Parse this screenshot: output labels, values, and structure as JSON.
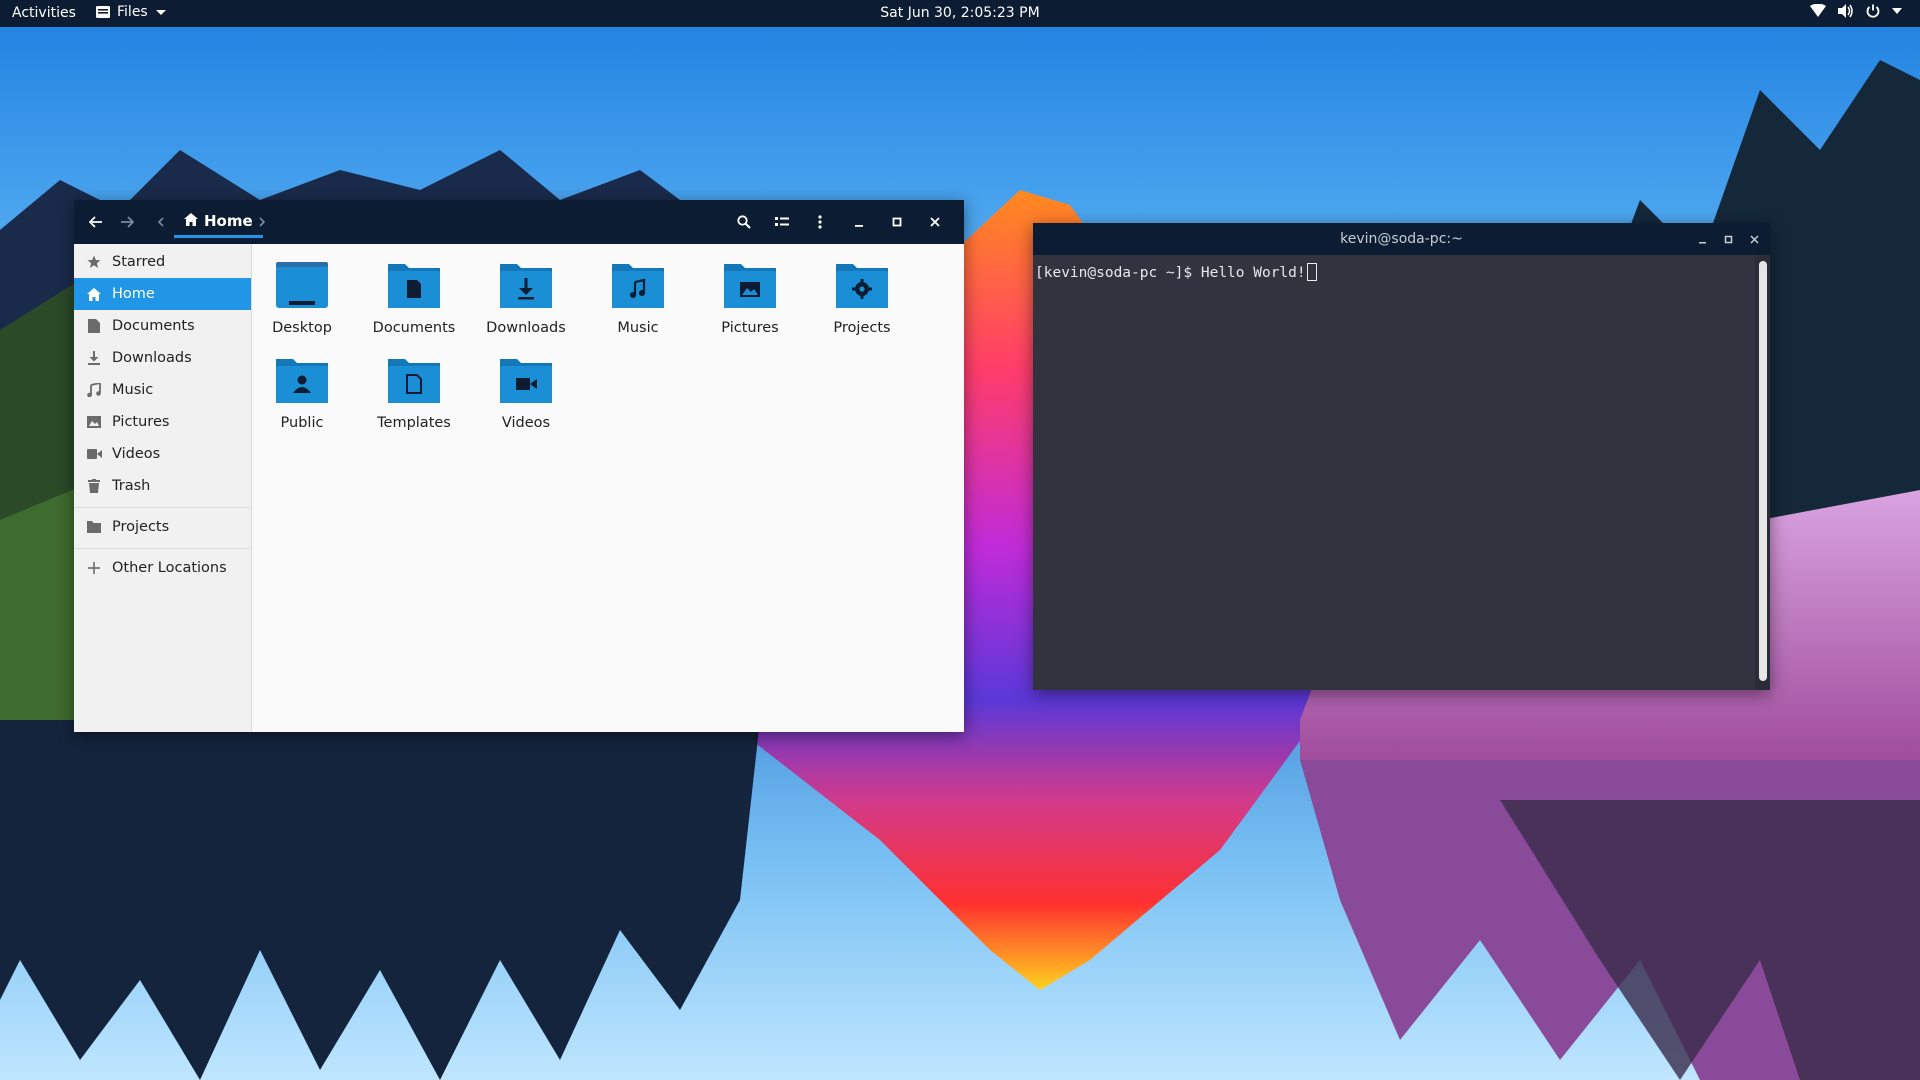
{
  "topbar": {
    "activities": "Activities",
    "app_menu": "Files",
    "clock": "Sat Jun 30,  2:05:23 PM",
    "tray_icons": [
      "network-icon",
      "volume-icon",
      "power-icon",
      "chevron-down-icon"
    ]
  },
  "files": {
    "path": "Home",
    "sidebar": {
      "items": [
        {
          "label": "Starred",
          "icon": "star-icon"
        },
        {
          "label": "Home",
          "icon": "home-icon",
          "active": true
        },
        {
          "label": "Documents",
          "icon": "document-icon"
        },
        {
          "label": "Downloads",
          "icon": "download-icon"
        },
        {
          "label": "Music",
          "icon": "music-icon"
        },
        {
          "label": "Pictures",
          "icon": "picture-icon"
        },
        {
          "label": "Videos",
          "icon": "video-icon"
        },
        {
          "label": "Trash",
          "icon": "trash-icon"
        },
        {
          "label": "Projects",
          "icon": "folder-icon"
        },
        {
          "label": "Other Locations",
          "icon": "plus-icon"
        }
      ]
    },
    "folders": [
      {
        "label": "Desktop",
        "icon": "desktop-folder-icon"
      },
      {
        "label": "Documents",
        "icon": "documents-folder-icon"
      },
      {
        "label": "Downloads",
        "icon": "downloads-folder-icon"
      },
      {
        "label": "Music",
        "icon": "music-folder-icon"
      },
      {
        "label": "Pictures",
        "icon": "pictures-folder-icon"
      },
      {
        "label": "Projects",
        "icon": "projects-folder-icon"
      },
      {
        "label": "Public",
        "icon": "public-folder-icon"
      },
      {
        "label": "Templates",
        "icon": "templates-folder-icon"
      },
      {
        "label": "Videos",
        "icon": "videos-folder-icon"
      }
    ]
  },
  "terminal": {
    "title": "kevin@soda-pc:~",
    "line": "[kevin@soda-pc ~]$ Hello World!"
  },
  "colors": {
    "header": "#0c1d33",
    "accent": "#2196e6",
    "folder": "#1a8fd6",
    "terminal_bg": "#333340"
  }
}
